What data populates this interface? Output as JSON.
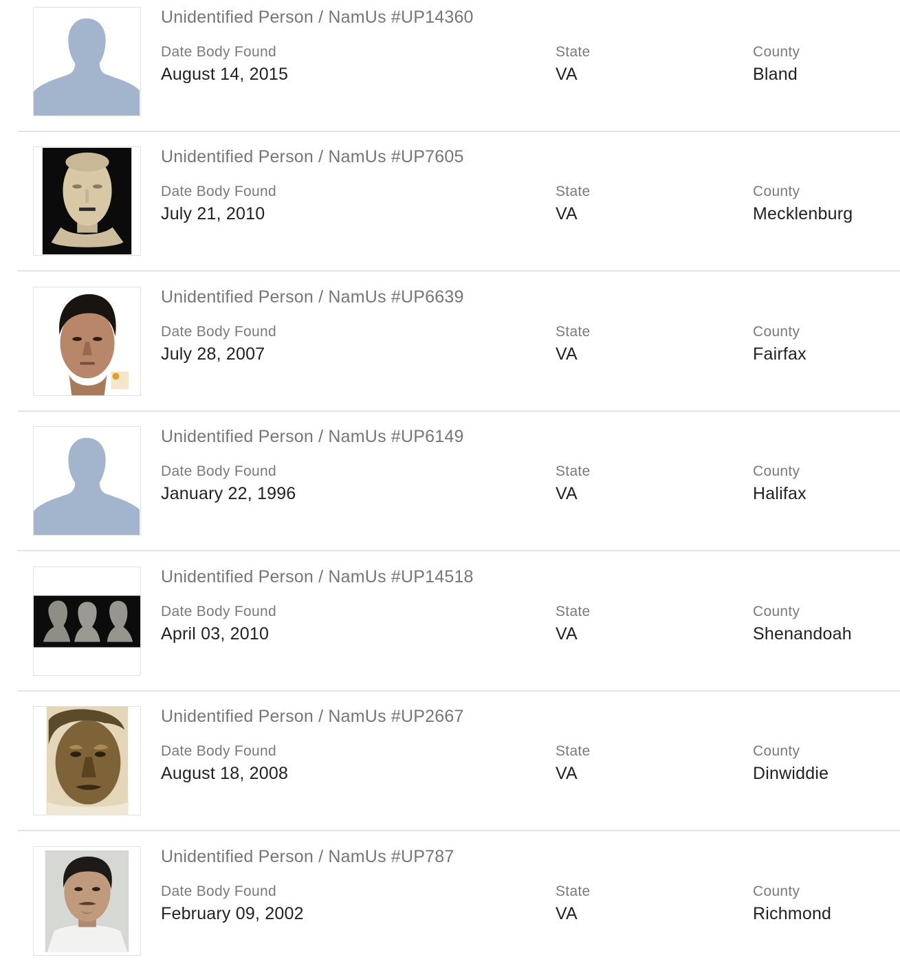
{
  "labels": {
    "date": "Date Body Found",
    "state": "State",
    "county": "County"
  },
  "cases": [
    {
      "title": "Unidentified Person / NamUs #UP14360",
      "date": "August 14, 2015",
      "state": "VA",
      "county": "Bland",
      "image": "silhouette-placeholder"
    },
    {
      "title": "Unidentified Person / NamUs #UP7605",
      "date": "July 21, 2010",
      "state": "VA",
      "county": "Mecklenburg",
      "image": "forensic-reconstruction-photo"
    },
    {
      "title": "Unidentified Person / NamUs #UP6639",
      "date": "July 28, 2007",
      "state": "VA",
      "county": "Fairfax",
      "image": "facial-reconstruction-portrait"
    },
    {
      "title": "Unidentified Person / NamUs #UP6149",
      "date": "January 22, 1996",
      "state": "VA",
      "county": "Halifax",
      "image": "silhouette-placeholder"
    },
    {
      "title": "Unidentified Person / NamUs #UP14518",
      "date": "April 03, 2010",
      "state": "VA",
      "county": "Shenandoah",
      "image": "three-angle-reconstruction"
    },
    {
      "title": "Unidentified Person / NamUs #UP2667",
      "date": "August 18, 2008",
      "state": "VA",
      "county": "Dinwiddie",
      "image": "sepia-sketch-portrait"
    },
    {
      "title": "Unidentified Person / NamUs #UP787",
      "date": "February 09, 2002",
      "state": "VA",
      "county": "Richmond",
      "image": "photo-portrait"
    }
  ],
  "colors": {
    "silhouette": "#a3b4cd",
    "title_text": "#767676",
    "label_text": "#7a7a7a",
    "value_text": "#222222",
    "divider": "#e4e4e4"
  }
}
